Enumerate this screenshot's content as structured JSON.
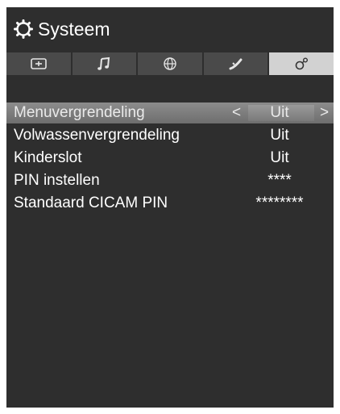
{
  "window": {
    "title": "Systeem",
    "title_icon": "gear-icon"
  },
  "tabs": [
    {
      "icon": "picture-icon",
      "active": false
    },
    {
      "icon": "music-icon",
      "active": false
    },
    {
      "icon": "globe-icon",
      "active": false
    },
    {
      "icon": "satellite-icon",
      "active": false
    },
    {
      "icon": "settings-icon",
      "active": true
    }
  ],
  "menu": {
    "items": [
      {
        "label": "Menuvergrendeling",
        "value": "Uit",
        "arrow_left": "<",
        "arrow_right": ">"
      },
      {
        "label": "Volwassenvergrendeling",
        "value": "Uit"
      },
      {
        "label": "Kinderslot",
        "value": "Uit"
      },
      {
        "label": "PIN instellen",
        "value": "****"
      },
      {
        "label": "Standaard CICAM PIN",
        "value": "********"
      }
    ]
  },
  "colors": {
    "panel_bg": "#2e2e2e",
    "tab_bg": "#4a4a4a",
    "tab_active_bg": "#d2d2d2",
    "selected_row": "#7d7d7d"
  }
}
